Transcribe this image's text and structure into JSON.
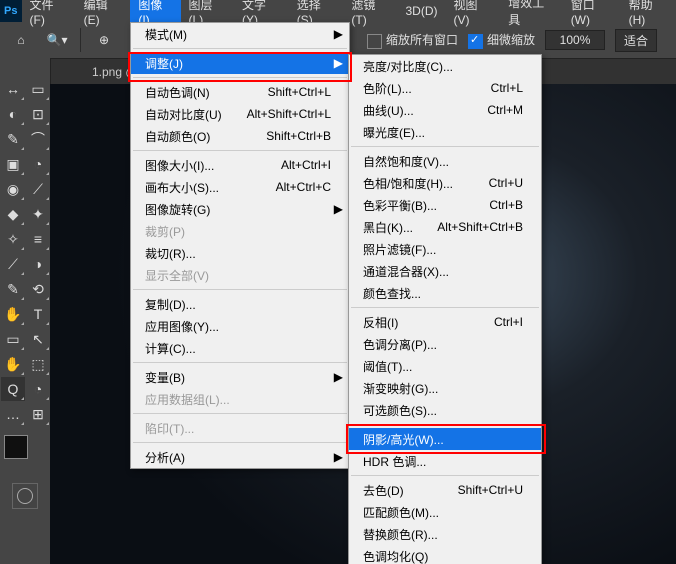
{
  "menubar": [
    "文件(F)",
    "编辑(E)",
    "图像(I)",
    "图层(L)",
    "文字(Y)",
    "选择(S)",
    "滤镜(T)",
    "3D(D)",
    "视图(V)",
    "增效工具",
    "窗口(W)",
    "帮助(H)"
  ],
  "optionbar": {
    "zoomAll": "缩放所有窗口",
    "scrubby": "细微缩放",
    "zoom": "100%",
    "fit": "适合"
  },
  "filetab": {
    "name": "1.png @",
    "close": "×"
  },
  "menu1": [
    {
      "t": "row",
      "l": "模式(M)",
      "arr": true
    },
    {
      "t": "sep"
    },
    {
      "t": "row",
      "l": "调整(J)",
      "arr": true,
      "hl": true
    },
    {
      "t": "sep"
    },
    {
      "t": "row",
      "l": "自动色调(N)",
      "s": "Shift+Ctrl+L"
    },
    {
      "t": "row",
      "l": "自动对比度(U)",
      "s": "Alt+Shift+Ctrl+L"
    },
    {
      "t": "row",
      "l": "自动颜色(O)",
      "s": "Shift+Ctrl+B"
    },
    {
      "t": "sep"
    },
    {
      "t": "row",
      "l": "图像大小(I)...",
      "s": "Alt+Ctrl+I"
    },
    {
      "t": "row",
      "l": "画布大小(S)...",
      "s": "Alt+Ctrl+C"
    },
    {
      "t": "row",
      "l": "图像旋转(G)",
      "arr": true
    },
    {
      "t": "row",
      "l": "裁剪(P)",
      "dis": true
    },
    {
      "t": "row",
      "l": "裁切(R)...",
      "dis": false
    },
    {
      "t": "row",
      "l": "显示全部(V)",
      "dis": true
    },
    {
      "t": "sep"
    },
    {
      "t": "row",
      "l": "复制(D)..."
    },
    {
      "t": "row",
      "l": "应用图像(Y)..."
    },
    {
      "t": "row",
      "l": "计算(C)..."
    },
    {
      "t": "sep"
    },
    {
      "t": "row",
      "l": "变量(B)",
      "arr": true
    },
    {
      "t": "row",
      "l": "应用数据组(L)...",
      "dis": true
    },
    {
      "t": "sep"
    },
    {
      "t": "row",
      "l": "陷印(T)...",
      "dis": true
    },
    {
      "t": "sep"
    },
    {
      "t": "row",
      "l": "分析(A)",
      "arr": true
    }
  ],
  "menu2": [
    {
      "t": "row",
      "l": "亮度/对比度(C)..."
    },
    {
      "t": "row",
      "l": "色阶(L)...",
      "s": "Ctrl+L"
    },
    {
      "t": "row",
      "l": "曲线(U)...",
      "s": "Ctrl+M"
    },
    {
      "t": "row",
      "l": "曝光度(E)..."
    },
    {
      "t": "sep"
    },
    {
      "t": "row",
      "l": "自然饱和度(V)..."
    },
    {
      "t": "row",
      "l": "色相/饱和度(H)...",
      "s": "Ctrl+U"
    },
    {
      "t": "row",
      "l": "色彩平衡(B)...",
      "s": "Ctrl+B"
    },
    {
      "t": "row",
      "l": "黑白(K)...",
      "s": "Alt+Shift+Ctrl+B"
    },
    {
      "t": "row",
      "l": "照片滤镜(F)..."
    },
    {
      "t": "row",
      "l": "通道混合器(X)..."
    },
    {
      "t": "row",
      "l": "颜色查找..."
    },
    {
      "t": "sep"
    },
    {
      "t": "row",
      "l": "反相(I)",
      "s": "Ctrl+I"
    },
    {
      "t": "row",
      "l": "色调分离(P)..."
    },
    {
      "t": "row",
      "l": "阈值(T)..."
    },
    {
      "t": "row",
      "l": "渐变映射(G)..."
    },
    {
      "t": "row",
      "l": "可选颜色(S)..."
    },
    {
      "t": "sep"
    },
    {
      "t": "row",
      "l": "阴影/高光(W)...",
      "hl": true
    },
    {
      "t": "row",
      "l": "HDR 色调..."
    },
    {
      "t": "sep"
    },
    {
      "t": "row",
      "l": "去色(D)",
      "s": "Shift+Ctrl+U"
    },
    {
      "t": "row",
      "l": "匹配颜色(M)..."
    },
    {
      "t": "row",
      "l": "替换颜色(R)..."
    },
    {
      "t": "row",
      "l": "色调均化(Q)"
    }
  ],
  "tools": [
    "↔",
    "▭",
    "◐",
    "⊡",
    "✎",
    "⌒",
    "▣",
    "◔",
    "◉",
    "⟋",
    "◆",
    "✦",
    "✧",
    "≡",
    "⟋",
    "◑",
    "✎",
    "⟲",
    "✋",
    "T",
    "▭",
    "↖",
    "✋",
    "⬚",
    "Q",
    "◔",
    "…",
    "⊞"
  ]
}
